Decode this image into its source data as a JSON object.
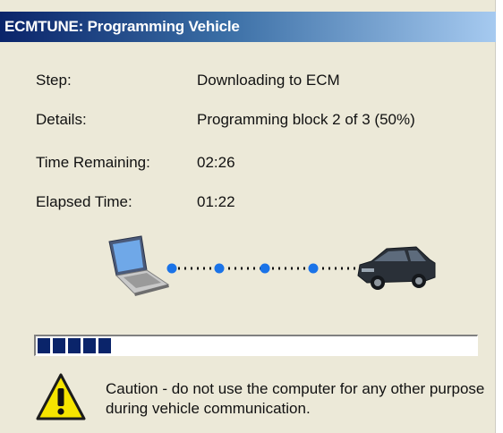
{
  "window": {
    "title": "ECMTUNE: Programming Vehicle"
  },
  "rows": [
    {
      "label": "Step:",
      "value": "Downloading to ECM"
    },
    {
      "label": "Details:",
      "value": "Programming block 2 of 3 (50%)"
    },
    {
      "label": "Time Remaining:",
      "value": "02:26"
    },
    {
      "label": "Elapsed Time:",
      "value": "01:22"
    }
  ],
  "illustration": {
    "left_icon": "laptop-icon",
    "right_icon": "car-icon",
    "link": "data-link-dots"
  },
  "progress": {
    "fraction": 0.17
  },
  "caution": {
    "icon": "warning-icon",
    "text": "Caution - do not use the computer for any other purpose during vehicle communication."
  },
  "colors": {
    "title_start": "#0a246a",
    "title_end": "#a6caf0",
    "progress": "#0a246a",
    "dot": "#1a73e8",
    "window_bg": "#ece9d8"
  }
}
